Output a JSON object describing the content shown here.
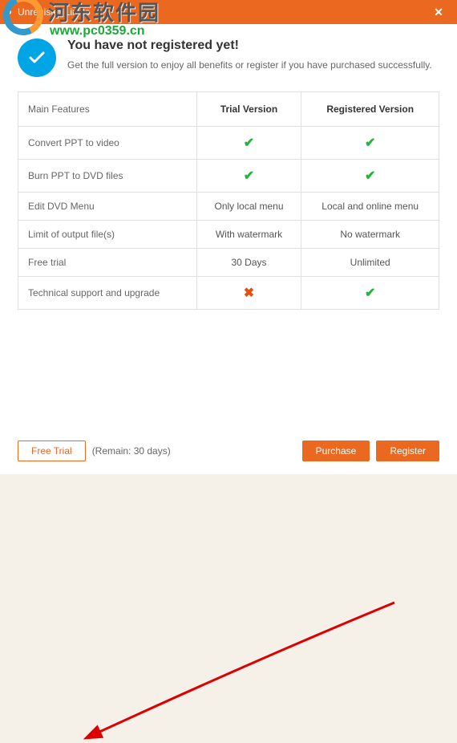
{
  "watermark": {
    "text": "河东软件园",
    "url": "www.pc0359.cn"
  },
  "titlebar": {
    "title": "Unregister Limits"
  },
  "header": {
    "title": "You have not registered yet!",
    "subtitle": "Get the full version to enjoy all benefits or register if you have purchased successfully."
  },
  "table": {
    "cols": [
      "Main Features",
      "Trial Version",
      "Registered Version"
    ],
    "rows": [
      {
        "feature": "Convert PPT to video",
        "trial": {
          "type": "check"
        },
        "reg": {
          "type": "check"
        }
      },
      {
        "feature": "Burn PPT to DVD files",
        "trial": {
          "type": "check"
        },
        "reg": {
          "type": "check"
        }
      },
      {
        "feature": "Edit DVD Menu",
        "trial": {
          "type": "text",
          "value": "Only local menu"
        },
        "reg": {
          "type": "text",
          "value": "Local and online menu"
        }
      },
      {
        "feature": "Limit of output file(s)",
        "trial": {
          "type": "text",
          "value": "With watermark"
        },
        "reg": {
          "type": "text",
          "value": "No watermark"
        }
      },
      {
        "feature": "Free trial",
        "trial": {
          "type": "text",
          "value": "30 Days"
        },
        "reg": {
          "type": "text",
          "value": "Unlimited"
        }
      },
      {
        "feature": "Technical support and upgrade",
        "trial": {
          "type": "cross"
        },
        "reg": {
          "type": "check"
        }
      }
    ]
  },
  "footer": {
    "free_trial": "Free Trial",
    "remain": "(Remain: 30 days)",
    "purchase": "Purchase",
    "register": "Register"
  }
}
